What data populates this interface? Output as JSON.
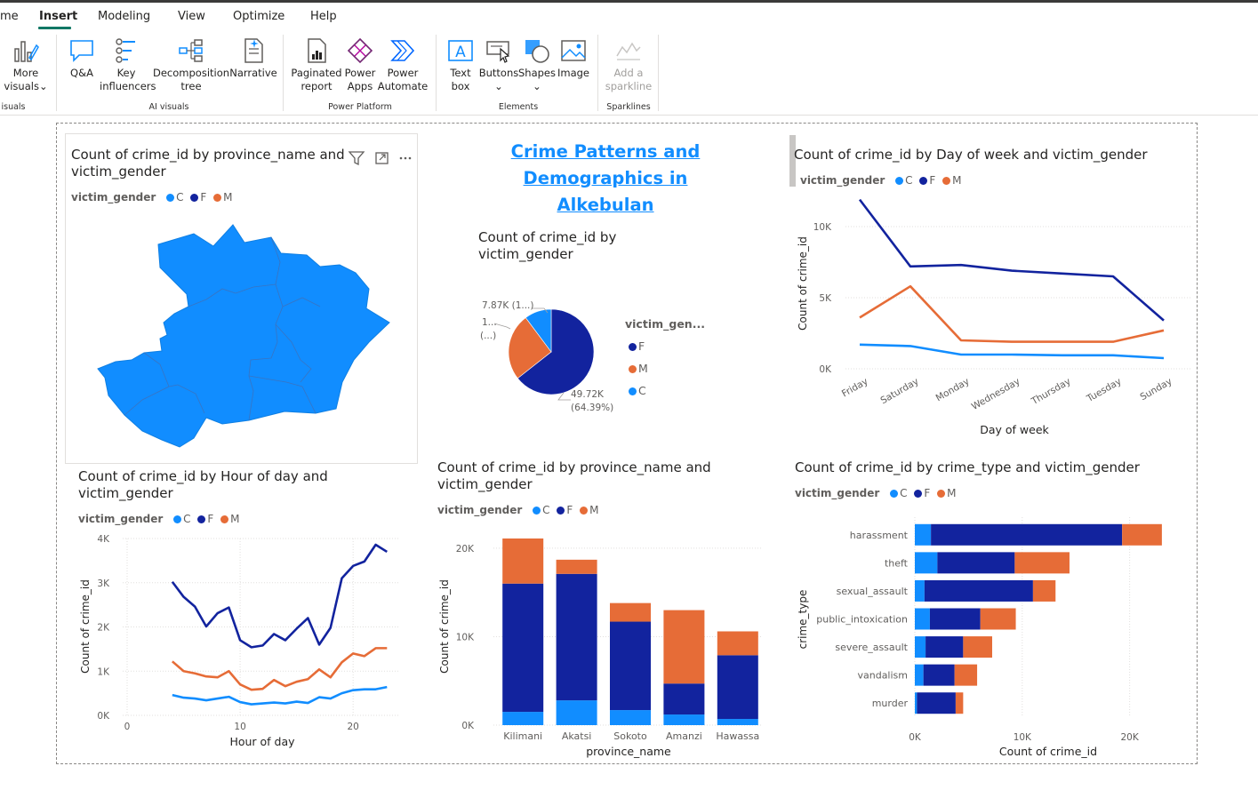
{
  "menu": {
    "tabs": [
      {
        "label": "me"
      },
      {
        "label": "Insert"
      },
      {
        "label": "Modeling"
      },
      {
        "label": "View"
      },
      {
        "label": "Optimize"
      },
      {
        "label": "Help"
      }
    ],
    "active": "Insert"
  },
  "ribbon": {
    "buttons": [
      {
        "label1": "More",
        "label2": "visuals",
        "icon": "more-visuals-icon"
      },
      {
        "label1": "Q&A",
        "label2": "",
        "icon": "qa-icon"
      },
      {
        "label1": "Key",
        "label2": "influencers",
        "icon": "key-influencers-icon"
      },
      {
        "label1": "Decomposition",
        "label2": "tree",
        "icon": "decomposition-tree-icon"
      },
      {
        "label1": "Narrative",
        "label2": "",
        "icon": "narrative-icon"
      },
      {
        "label1": "Paginated",
        "label2": "report",
        "icon": "paginated-report-icon"
      },
      {
        "label1": "Power",
        "label2": "Apps",
        "icon": "power-apps-icon"
      },
      {
        "label1": "Power",
        "label2": "Automate",
        "icon": "power-automate-icon"
      },
      {
        "label1": "Text",
        "label2": "box",
        "icon": "text-box-icon"
      },
      {
        "label1": "Buttons",
        "label2": "",
        "icon": "buttons-icon"
      },
      {
        "label1": "Shapes",
        "label2": "",
        "icon": "shapes-icon"
      },
      {
        "label1": "Image",
        "label2": "",
        "icon": "image-icon"
      },
      {
        "label1": "Add a",
        "label2": "sparkline",
        "icon": "sparkline-icon"
      }
    ],
    "groups": [
      "isuals",
      "AI visuals",
      "Power Platform",
      "Elements",
      "Sparklines"
    ]
  },
  "report_title": {
    "line1": "Crime Patterns and Demographics in",
    "line2": "Alkebulan"
  },
  "legend_title": "victim_gender",
  "colors": {
    "C": "#118dff",
    "F": "#12239e",
    "M": "#e66c37"
  },
  "map_visual": {
    "title1": "Count of crime_id by province_name and",
    "title2": "victim_gender"
  },
  "pie_visual": {
    "title1": "Count of crime_id by",
    "title2": "victim_gender",
    "legend_title": "victim_gen...",
    "legend_items": [
      "F",
      "M",
      "C"
    ],
    "labels": {
      "C": "7.87K (1...)",
      "M1": "1...",
      "M2": "(...)",
      "F1": "49.72K",
      "F2": "(64.39%)"
    }
  },
  "day_visual": {
    "title": "Count of crime_id by Day of week and victim_gender"
  },
  "hour_visual": {
    "title1": "Count of crime_id by Hour of day and",
    "title2": "victim_gender"
  },
  "province_visual": {
    "title1": "Count of crime_id by province_name and",
    "title2": "victim_gender"
  },
  "crime_visual": {
    "title": "Count of crime_id by crime_type and victim_gender"
  },
  "chart_data": [
    {
      "type": "pie",
      "categories": [
        "F",
        "M",
        "C"
      ],
      "values": [
        49720,
        19630,
        7870
      ],
      "title": "Count of crime_id by victim_gender"
    },
    {
      "type": "line",
      "title": "Count of crime_id by Day of week and victim_gender",
      "xlabel": "Day of week",
      "ylabel": "Count of crime_id",
      "categories": [
        "Friday",
        "Saturday",
        "Monday",
        "Wednesday",
        "Thursday",
        "Tuesday",
        "Sunday"
      ],
      "series": [
        {
          "name": "F",
          "values": [
            11900,
            7200,
            7300,
            6900,
            6700,
            6500,
            3400
          ]
        },
        {
          "name": "M",
          "values": [
            3600,
            5800,
            2000,
            1900,
            1900,
            1900,
            2700
          ]
        },
        {
          "name": "C",
          "values": [
            1700,
            1600,
            1000,
            1000,
            950,
            950,
            750
          ]
        }
      ],
      "ylim": [
        0,
        12000
      ],
      "yticks": [
        "0K",
        "5K",
        "10K"
      ],
      "grid": true
    },
    {
      "type": "line",
      "title": "Count of crime_id by Hour of day and victim_gender",
      "xlabel": "Hour of day",
      "ylabel": "Count of crime_id",
      "x": [
        4,
        5,
        6,
        7,
        8,
        9,
        10,
        11,
        12,
        13,
        14,
        15,
        16,
        17,
        18,
        19,
        20,
        21,
        22,
        23
      ],
      "series": [
        {
          "name": "F",
          "values": [
            3020,
            2680,
            2460,
            2010,
            2310,
            2440,
            1700,
            1540,
            1580,
            1840,
            1700,
            1960,
            2200,
            1600,
            1980,
            3100,
            3380,
            3480,
            3860,
            3700
          ]
        },
        {
          "name": "M",
          "values": [
            1220,
            1000,
            950,
            880,
            860,
            1000,
            700,
            580,
            600,
            800,
            660,
            760,
            820,
            1040,
            860,
            1200,
            1400,
            1340,
            1520,
            1520
          ]
        },
        {
          "name": "C",
          "values": [
            460,
            400,
            380,
            340,
            380,
            420,
            300,
            250,
            270,
            290,
            270,
            310,
            280,
            410,
            380,
            500,
            570,
            590,
            590,
            640
          ]
        }
      ],
      "xlim": [
        0,
        24
      ],
      "ylim": [
        0,
        4000
      ],
      "xticks": [
        "0",
        "10",
        "20"
      ],
      "yticks": [
        "0K",
        "1K",
        "2K",
        "3K",
        "4K"
      ],
      "grid": true
    },
    {
      "type": "bar",
      "title": "Count of crime_id by province_name and victim_gender",
      "xlabel": "province_name",
      "ylabel": "Count of crime_id",
      "categories": [
        "Kilimani",
        "Akatsi",
        "Sokoto",
        "Amanzi",
        "Hawassa"
      ],
      "stacked": true,
      "series": [
        {
          "name": "C",
          "values": [
            1500,
            2800,
            1700,
            1200,
            700
          ]
        },
        {
          "name": "F",
          "values": [
            14500,
            14300,
            10000,
            3500,
            7200
          ]
        },
        {
          "name": "M",
          "values": [
            5100,
            1600,
            2100,
            8300,
            2700
          ]
        }
      ],
      "ylim": [
        0,
        22000
      ],
      "yticks": [
        "0K",
        "10K",
        "20K"
      ],
      "grid": true
    },
    {
      "type": "bar",
      "orientation": "horizontal",
      "title": "Count of crime_id by crime_type and victim_gender",
      "xlabel": "Count of crime_id",
      "ylabel": "crime_type",
      "categories": [
        "harassment",
        "theft",
        "sexual_assault",
        "public_intoxication",
        "severe_assault",
        "vandalism",
        "murder"
      ],
      "stacked": true,
      "series": [
        {
          "name": "C",
          "values": [
            1500,
            2100,
            900,
            1400,
            1000,
            800,
            200
          ]
        },
        {
          "name": "F",
          "values": [
            17800,
            7200,
            10100,
            4700,
            3500,
            2900,
            3600
          ]
        },
        {
          "name": "M",
          "values": [
            3700,
            5100,
            2100,
            3300,
            2700,
            2100,
            700
          ]
        }
      ],
      "xlim": [
        0,
        24500
      ],
      "xticks": [
        "0K",
        "10K",
        "20K"
      ],
      "grid": true
    }
  ]
}
